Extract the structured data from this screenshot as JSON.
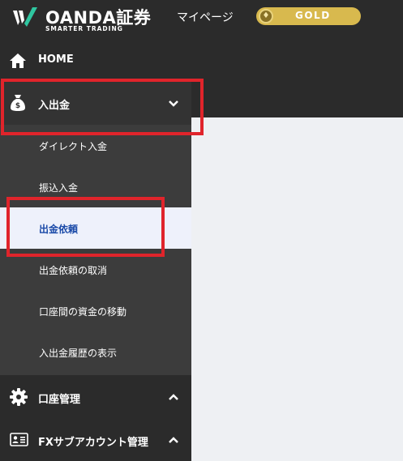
{
  "header": {
    "brand": "OANDA証券",
    "tagline": "SMARTER TRADING",
    "mypage_label": "マイページ",
    "badge_label": "GOLD"
  },
  "sidebar": {
    "home_label": "HOME",
    "deposit_label": "入出金",
    "deposit_submenu": [
      {
        "label": "ダイレクト入金"
      },
      {
        "label": "振込入金"
      },
      {
        "label": "出金依頼",
        "active": true
      },
      {
        "label": "出金依頼の取消"
      },
      {
        "label": "口座間の資金の移動"
      },
      {
        "label": "入出金履歴の表示"
      }
    ],
    "account_label": "口座管理",
    "fx_sub_label": "FXサブアカウント管理"
  },
  "colors": {
    "header_bg": "#2b2b2b",
    "sidebar_bg": "#333333",
    "submenu_bg": "#3c3c3c",
    "active_bg": "#eef1fb",
    "active_text": "#1a4aa8",
    "gold": "#d8b94e",
    "highlight": "#e0242b",
    "content_bg": "#eef0f3"
  }
}
